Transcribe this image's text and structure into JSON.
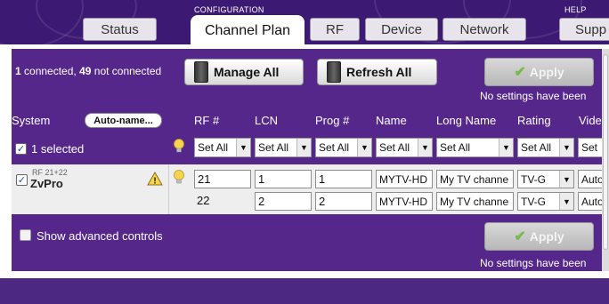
{
  "header": {
    "configuration_label": "CONFIGURATION",
    "help_label": "HELP",
    "tabs": [
      {
        "label": "Status"
      },
      {
        "label": "Channel Plan"
      },
      {
        "label": "RF"
      },
      {
        "label": "Device"
      },
      {
        "label": "Network"
      },
      {
        "label": "Supp"
      }
    ],
    "active_tab": "Channel Plan"
  },
  "toolbar": {
    "connected_count": "1",
    "connected_text": " connected, ",
    "not_connected_count": "49",
    "not_connected_text": " not connected",
    "manage_all_label": "Manage All",
    "refresh_all_label": "Refresh All",
    "apply_label": "Apply",
    "status_note": "No settings have been"
  },
  "table": {
    "columns": {
      "system": "System",
      "rf": "RF #",
      "lcn": "LCN",
      "prog": "Prog #",
      "name": "Name",
      "long_name": "Long Name",
      "rating": "Rating",
      "video": "Vide"
    },
    "auto_name_label": "Auto-name...",
    "selected_text": "1 selected",
    "set_all": {
      "rf": "Set All",
      "lcn": "Set All",
      "prog": "Set All",
      "name": "Set All",
      "long_name": "Set All",
      "rating": "Set All",
      "video": "Set"
    },
    "device": {
      "sub_label": "RF 21+22",
      "name": "ZvPro",
      "warning": "!"
    },
    "rows": [
      {
        "rf": "21",
        "lcn": "1",
        "prog": "1",
        "name": "MYTV-HD",
        "long_name": "My TV channe",
        "rating": "TV-G",
        "video": "Auto"
      },
      {
        "rf": "22",
        "lcn": "2",
        "prog": "2",
        "name": "MYTV-HD",
        "long_name": "My TV channe",
        "rating": "TV-G",
        "video": "Auto"
      }
    ]
  },
  "footer": {
    "advanced_label": "Show advanced controls",
    "apply_label": "Apply",
    "status_note": "No settings have been"
  },
  "colors": {
    "header_bg": "#3c1a73",
    "panel_bg": "#55278a",
    "apply_check": "#7ab84a"
  },
  "icons": [
    "check-icon",
    "lightbulb-icon",
    "warning-icon",
    "device-icon",
    "chevron-down-icon"
  ]
}
